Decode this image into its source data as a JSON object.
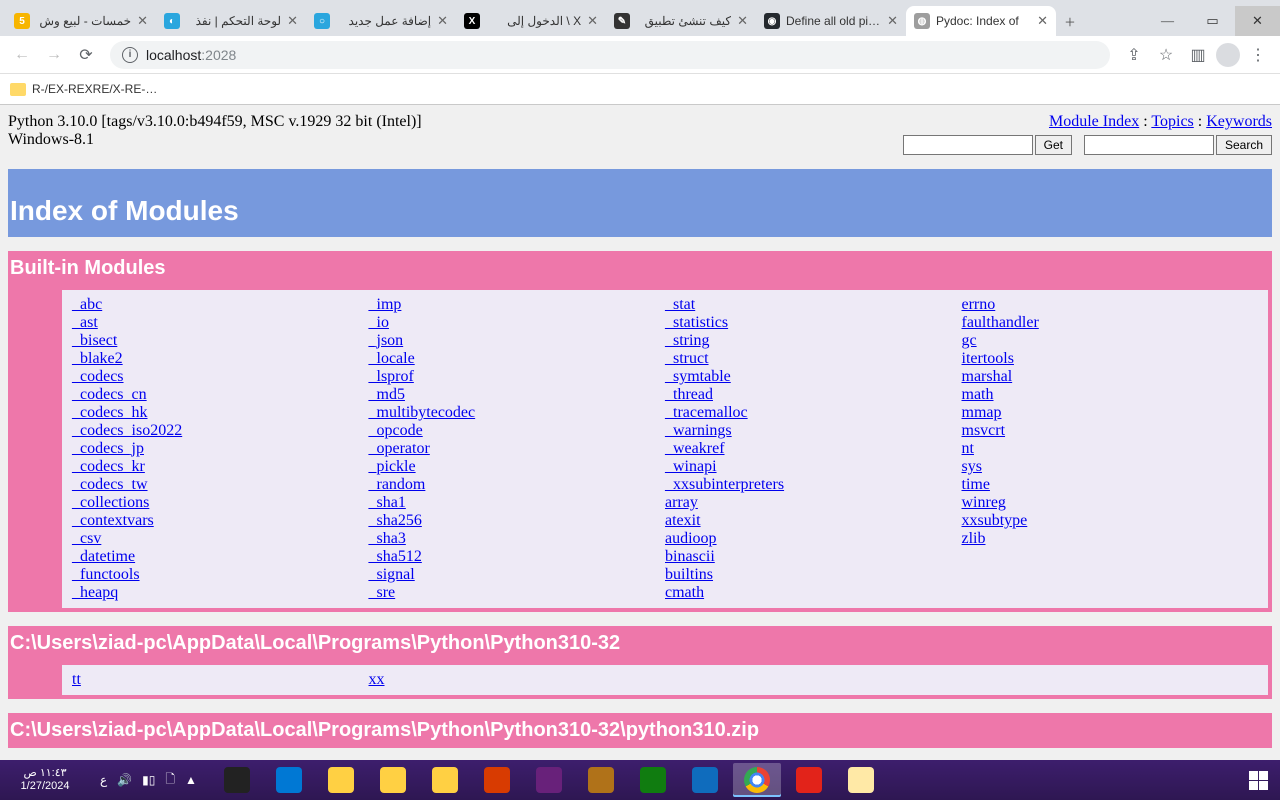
{
  "browser": {
    "tabs": [
      {
        "title": "خمسات - لبيع وش",
        "fav_bg": "#f7b500",
        "fav_txt": "5",
        "rtl": true
      },
      {
        "title": "لوحة التحكم | نفذ",
        "fav_bg": "#2aa6de",
        "fav_txt": "◐",
        "rtl": true
      },
      {
        "title": "إضافة عمل جديد",
        "fav_bg": "#2aa6de",
        "fav_txt": "○",
        "rtl": true
      },
      {
        "title": "X \\ الدخول إلى",
        "fav_bg": "#000",
        "fav_txt": "X",
        "rtl": true
      },
      {
        "title": "كيف تنشئ تطبيق",
        "fav_bg": "#333",
        "fav_txt": "✎",
        "rtl": true
      },
      {
        "title": "Define all old pi…",
        "fav_bg": "#24292e",
        "fav_txt": "◉",
        "rtl": false
      },
      {
        "title": "Pydoc: Index of",
        "fav_bg": "#9e9e9e",
        "fav_txt": "◍",
        "rtl": false,
        "active": true
      }
    ],
    "url_host": "localhost",
    "url_port": ":2028",
    "bookmark": "R-/EX-REXRE/X-RE-…"
  },
  "page": {
    "python_line": "Python 3.10.0 [tags/v3.10.0:b494f59, MSC v.1929 32 bit (Intel)]",
    "os_line": "Windows-8.1",
    "nav_links": {
      "module_index": "Module Index",
      "sep": " : ",
      "topics": "Topics",
      "keywords": "Keywords"
    },
    "get_btn": "Get",
    "search_btn": "Search",
    "title": "Index of Modules",
    "builtin_title": "Built-in Modules",
    "builtin_cols": [
      [
        "_abc",
        "_ast",
        "_bisect",
        "_blake2",
        "_codecs",
        "_codecs_cn",
        "_codecs_hk",
        "_codecs_iso2022",
        "_codecs_jp",
        "_codecs_kr",
        "_codecs_tw",
        "_collections",
        "_contextvars",
        "_csv",
        "_datetime",
        "_functools",
        "_heapq"
      ],
      [
        "_imp",
        "_io",
        "_json",
        "_locale",
        "_lsprof",
        "_md5",
        "_multibytecodec",
        "_opcode",
        "_operator",
        "_pickle",
        "_random",
        "_sha1",
        "_sha256",
        "_sha3",
        "_sha512",
        "_signal",
        "_sre"
      ],
      [
        "_stat",
        "_statistics",
        "_string",
        "_struct",
        "_symtable",
        "_thread",
        "_tracemalloc",
        "_warnings",
        "_weakref",
        "_winapi",
        "_xxsubinterpreters",
        "array",
        "atexit",
        "audioop",
        "binascii",
        "builtins",
        "cmath"
      ],
      [
        "errno",
        "faulthandler",
        "gc",
        "itertools",
        "marshal",
        "math",
        "mmap",
        "msvcrt",
        "nt",
        "sys",
        "time",
        "winreg",
        "xxsubtype",
        "zlib"
      ]
    ],
    "dir1_title": "C:\\Users\\ziad-pc\\AppData\\Local\\Programs\\Python\\Python310-32",
    "dir1_cols": [
      [
        "tt"
      ],
      [
        "xx"
      ],
      [],
      []
    ],
    "dir2_title": "C:\\Users\\ziad-pc\\AppData\\Local\\Programs\\Python\\Python310-32\\python310.zip"
  },
  "taskbar": {
    "time": "١١:٤٣ ص",
    "date": "1/27/2024",
    "lang": "ع"
  }
}
